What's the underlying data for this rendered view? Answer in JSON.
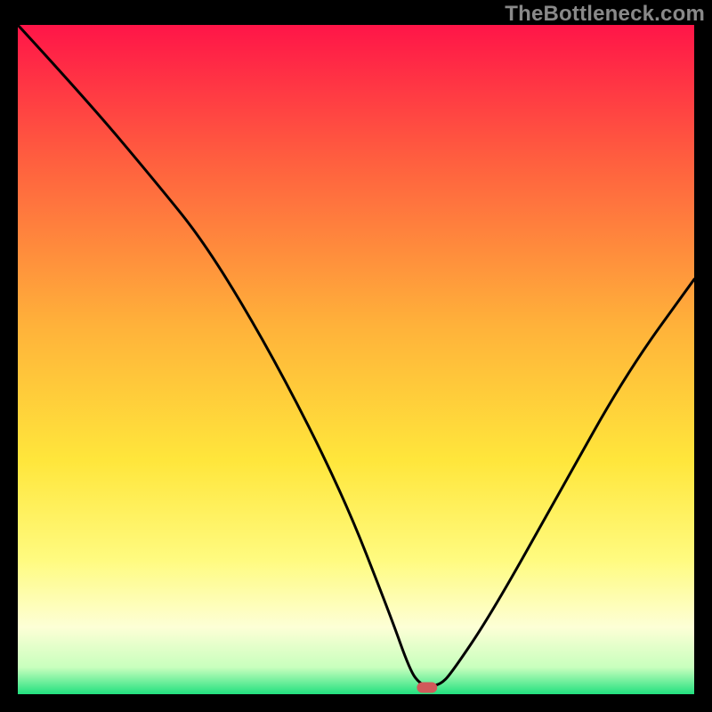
{
  "watermark": "TheBottleneck.com",
  "chart_data": {
    "type": "line",
    "title": "",
    "xlabel": "",
    "ylabel": "",
    "xlim": [
      0,
      100
    ],
    "ylim": [
      0,
      100
    ],
    "grid": false,
    "legend": false,
    "series": [
      {
        "name": "bottleneck-curve",
        "x": [
          0,
          10,
          20,
          28,
          38,
          48,
          55,
          58,
          59.5,
          61,
          62.5,
          64,
          70,
          80,
          90,
          100
        ],
        "y": [
          100,
          89,
          77,
          67,
          50,
          30,
          12,
          3.5,
          1.5,
          1.2,
          1.5,
          3,
          12,
          30,
          48,
          62
        ]
      }
    ],
    "minimum_marker": {
      "x": 60.5,
      "y": 1.0,
      "width": 3.0,
      "height": 1.6,
      "color": "#d05a5a"
    },
    "gradient_stops": [
      {
        "offset": 0,
        "color": "#ff1548"
      },
      {
        "offset": 20,
        "color": "#ff5e3f"
      },
      {
        "offset": 45,
        "color": "#ffb23a"
      },
      {
        "offset": 65,
        "color": "#ffe63b"
      },
      {
        "offset": 80,
        "color": "#fffb80"
      },
      {
        "offset": 90,
        "color": "#fdffd6"
      },
      {
        "offset": 96,
        "color": "#c8ffbd"
      },
      {
        "offset": 100,
        "color": "#22e07f"
      }
    ]
  }
}
